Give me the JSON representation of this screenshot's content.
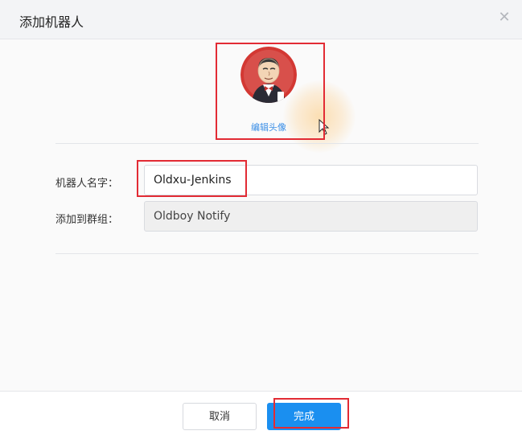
{
  "dialog": {
    "title": "添加机器人",
    "close_icon": "close-icon"
  },
  "avatar": {
    "image": "jenkins-butler-avatar",
    "edit_label": "编辑头像"
  },
  "form": {
    "robot_name_label": "机器人名字：",
    "robot_name_value": "Oldxu-Jenkins",
    "group_label": "添加到群组：",
    "group_value": "Oldboy Notify"
  },
  "footer": {
    "cancel_label": "取消",
    "confirm_label": "完成"
  },
  "colors": {
    "primary": "#1a8ff0",
    "link": "#3a8ee6",
    "highlight": "#e22b34"
  }
}
